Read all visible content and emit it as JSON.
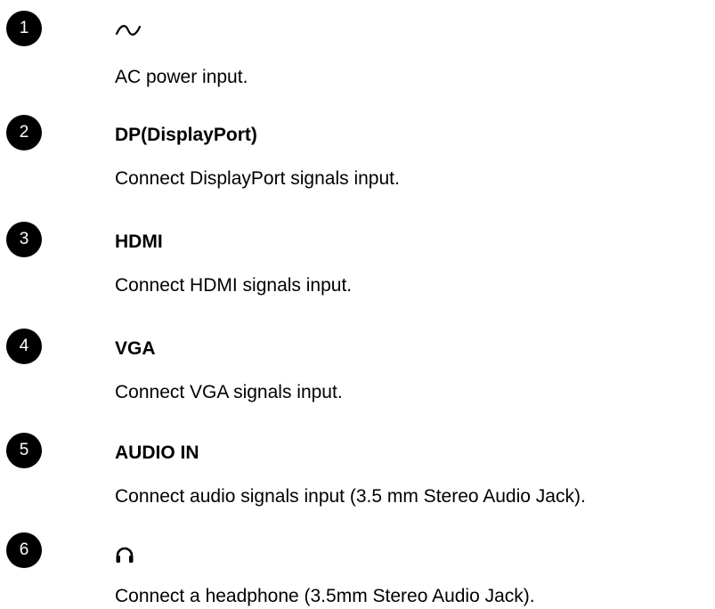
{
  "items": [
    {
      "number": "1",
      "icon": "ac-power-icon",
      "description": "AC power input."
    },
    {
      "number": "2",
      "heading": "DP(DisplayPort)",
      "description": "Connect DisplayPort signals input."
    },
    {
      "number": "3",
      "heading": "HDMI",
      "description": "Connect HDMI signals input."
    },
    {
      "number": "4",
      "heading": "VGA",
      "description": "Connect VGA signals input."
    },
    {
      "number": "5",
      "heading": "AUDIO IN",
      "description": "Connect audio signals input (3.5 mm Stereo Audio Jack)."
    },
    {
      "number": "6",
      "icon": "headphone-icon",
      "description": "Connect a headphone (3.5mm Stereo Audio Jack)."
    }
  ]
}
